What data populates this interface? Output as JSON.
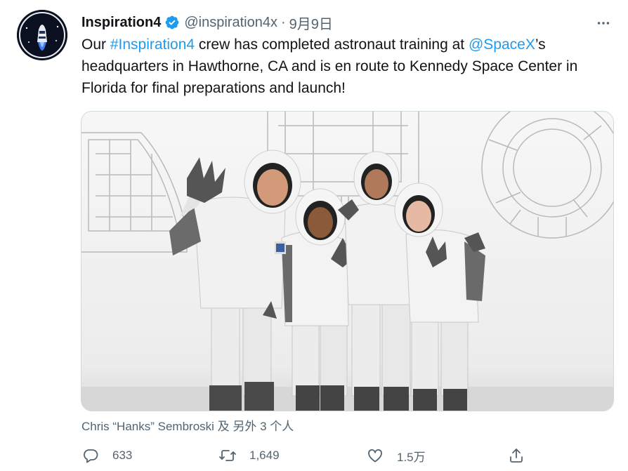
{
  "tweet": {
    "display_name": "Inspiration4",
    "handle": "@inspiration4x",
    "separator": "·",
    "date": "9月9日",
    "text": {
      "part1": "Our ",
      "hashtag": "#Inspiration4",
      "part2": " crew has completed astronaut training at ",
      "mention": "@SpaceX",
      "part3": "’s headquarters in Hawthorne, CA and is en route to Kennedy Space Center in Florida for final preparations and launch!"
    },
    "media_tag": "Chris “Hanks” Sembroski 及 另外 3 个人"
  },
  "actions": {
    "reply_count": "633",
    "retweet_count": "1,649",
    "like_count": "1.5万"
  },
  "colors": {
    "link": "#1d9bf0",
    "secondary_text": "#536471",
    "primary_text": "#0f1419",
    "verified": "#1d9bf0"
  },
  "icons": {
    "more": "more-icon",
    "verified": "verified-badge-icon",
    "reply": "reply-icon",
    "retweet": "retweet-icon",
    "like": "like-icon",
    "share": "share-icon"
  }
}
